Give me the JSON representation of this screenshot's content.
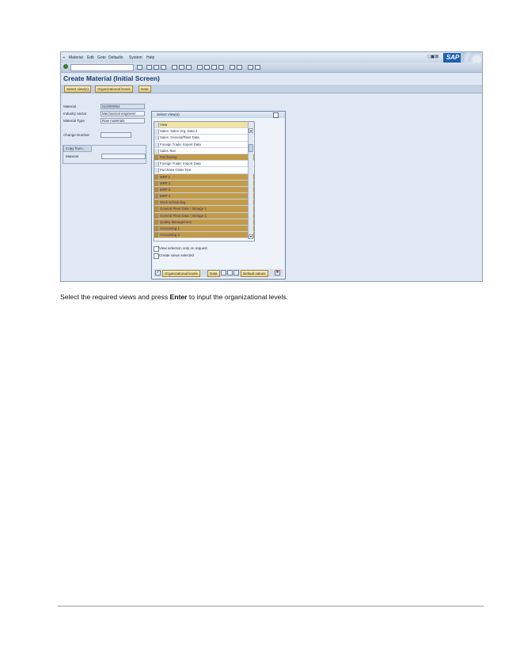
{
  "menu": [
    "Material",
    "Edit",
    "Goto",
    "Defaults",
    "System",
    "Help"
  ],
  "logo": "SAP",
  "screen_title": "Create Material (Initial Screen)",
  "app_toolbar": [
    "Select view(s)",
    "Organizational levels",
    "Data"
  ],
  "fields": {
    "material_label": "Material",
    "material_value": "010000054",
    "industry_label": "Industry sector",
    "industry_value": "Mechanical engineeri",
    "type_label": "Material Type",
    "type_value": "Raw materials",
    "change_label": "Change Number"
  },
  "copy_from": {
    "tab": "Copy from...",
    "material_label": "Material"
  },
  "popup": {
    "title": "Select View(s)",
    "header": "View",
    "views": [
      {
        "label": "Sales: Sales Org. Data 2",
        "selected": false
      },
      {
        "label": "Sales: General/Plant Data",
        "selected": false
      },
      {
        "label": "Foreign Trade: Export Data",
        "selected": false
      },
      {
        "label": "Sales Text",
        "selected": false
      },
      {
        "label": "Purchasing",
        "selected": true
      },
      {
        "label": "Foreign Trade: Import Data",
        "selected": false
      },
      {
        "label": "Purchase Order Text",
        "selected": false
      },
      {
        "label": "MRP 1",
        "selected": true
      },
      {
        "label": "MRP 2",
        "selected": true
      },
      {
        "label": "MRP 3",
        "selected": true
      },
      {
        "label": "MRP 4",
        "selected": true
      },
      {
        "label": "Work Scheduling",
        "selected": true
      },
      {
        "label": "General Plant Data / Storage 1",
        "selected": true
      },
      {
        "label": "General Plant Data / Storage 2",
        "selected": true
      },
      {
        "label": "Quality Management",
        "selected": true
      },
      {
        "label": "Accounting 1",
        "selected": true
      },
      {
        "label": "Accounting 2",
        "selected": true
      }
    ],
    "checkbox1": "View selection only on request",
    "checkbox2": "Create views selected",
    "btn_org": "Organizational levels",
    "btn_data": "Data",
    "btn_default": "Default values"
  },
  "caption": {
    "before": "Select the required views and press ",
    "bold": "Enter",
    "after": " to input the organizational levels."
  }
}
